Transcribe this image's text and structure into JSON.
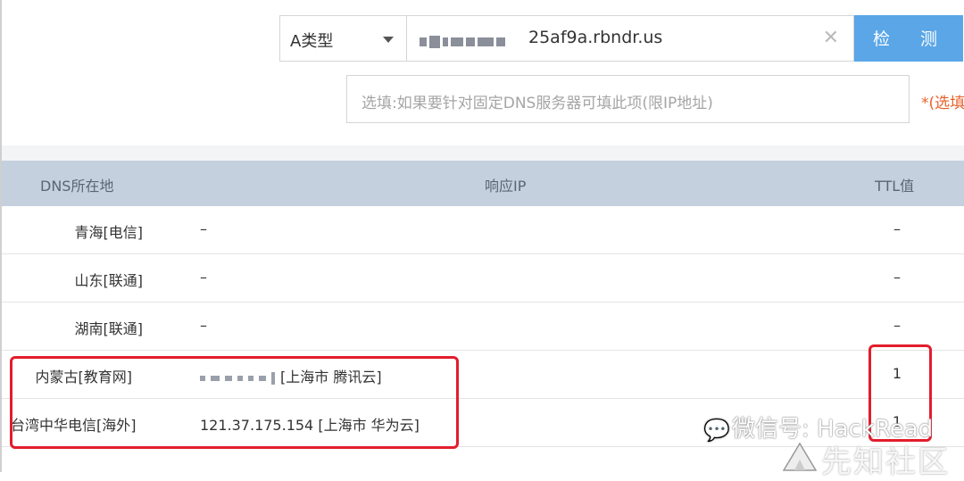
{
  "query": {
    "record_type": "A类型",
    "domain_visible": "25af9a.rbndr.us",
    "detect_label": "检 测"
  },
  "dns_server": {
    "placeholder": "选填:如果要针对固定DNS服务器可填此项(限IP地址)",
    "note": "*(选填"
  },
  "table": {
    "headers": {
      "location": "DNS所在地",
      "ip": "响应IP",
      "ttl": "TTL值"
    },
    "rows": [
      {
        "location": "青海[电信]",
        "ip": "–",
        "ttl": "–"
      },
      {
        "location": "山东[联通]",
        "ip": "–",
        "ttl": "–"
      },
      {
        "location": "湖南[联通]",
        "ip": "–",
        "ttl": "–"
      },
      {
        "location": "内蒙古[教育网]",
        "ip": "[上海市 腾讯云]",
        "ttl": "1"
      },
      {
        "location": "台湾中华电信[海外]",
        "ip": "121.37.175.154 [上海市 华为云]",
        "ttl": "1"
      }
    ]
  },
  "watermarks": {
    "wechat": "微信号: HackRead",
    "site": "先知社区"
  },
  "colors": {
    "accent": "#5aa6e7",
    "header_bg": "#c5d0df",
    "highlight": "#e21d2d",
    "note": "#e8622c"
  }
}
